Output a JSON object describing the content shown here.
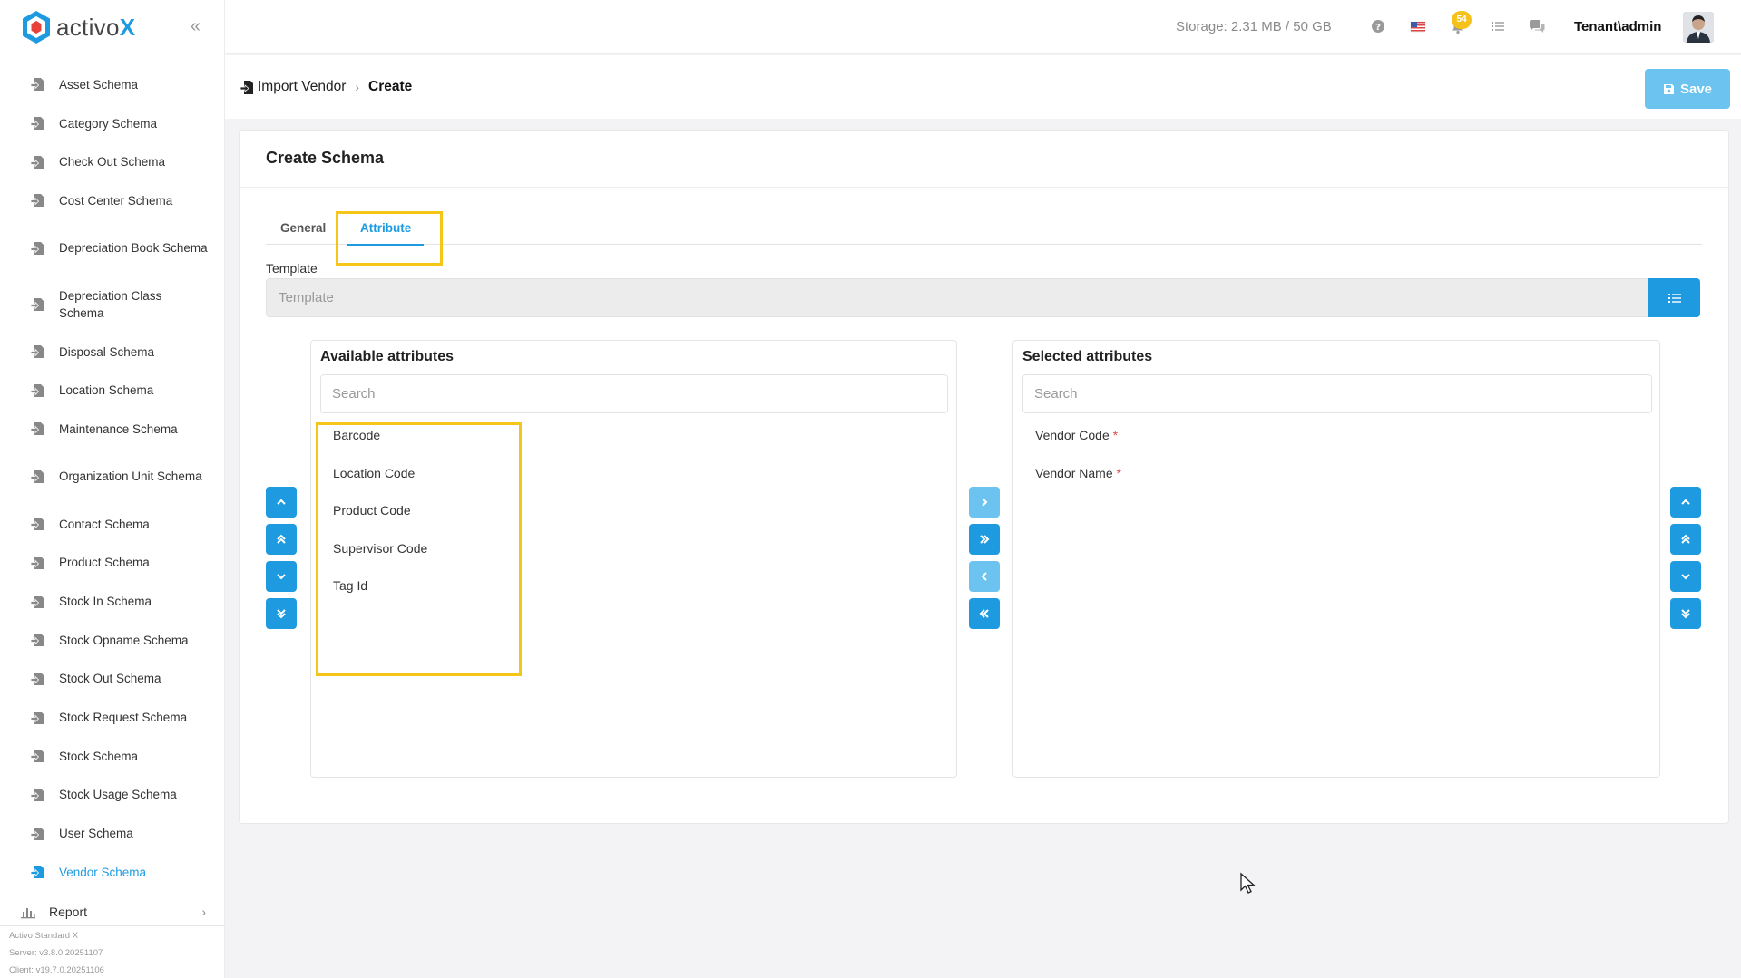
{
  "app": {
    "brand_text": "activo",
    "brand_x": "X",
    "brand_color": "#1e9be0",
    "accent_color": "#1e9be0",
    "highlight_color": "#f5c518"
  },
  "sidebar": {
    "items": [
      {
        "label": "Asset Schema"
      },
      {
        "label": "Category Schema"
      },
      {
        "label": "Check Out Schema"
      },
      {
        "label": "Cost Center Schema"
      },
      {
        "label": "Depreciation Book Schema"
      },
      {
        "label": "Depreciation Class Schema"
      },
      {
        "label": "Disposal Schema"
      },
      {
        "label": "Location Schema"
      },
      {
        "label": "Maintenance Schema"
      },
      {
        "label": "Organization Unit Schema"
      },
      {
        "label": "Contact Schema"
      },
      {
        "label": "Product Schema"
      },
      {
        "label": "Stock In Schema"
      },
      {
        "label": "Stock Opname Schema"
      },
      {
        "label": "Stock Out Schema"
      },
      {
        "label": "Stock Request Schema"
      },
      {
        "label": "Stock Schema"
      },
      {
        "label": "Stock Usage Schema"
      },
      {
        "label": "User Schema"
      },
      {
        "label": "Vendor Schema",
        "active": true
      }
    ],
    "report_label": "Report",
    "version_product": "Activo Standard X",
    "version_server": "Server: v3.8.0.20251107",
    "version_client": "Client: v19.7.0.20251106"
  },
  "header": {
    "storage": "Storage: 2.31 MB / 50 GB",
    "notification_count": "54",
    "user": "Tenant\\admin",
    "icons": [
      "help-icon",
      "us-flag-icon",
      "bell-icon",
      "task-list-icon",
      "chat-icon"
    ]
  },
  "page": {
    "breadcrumb_parent": "Import Vendor",
    "breadcrumb_current": "Create",
    "save_label": "Save"
  },
  "card": {
    "title": "Create Schema",
    "tabs": [
      {
        "label": "General"
      },
      {
        "label": "Attribute",
        "active": true
      }
    ],
    "template_label": "Template",
    "template_placeholder": "Template"
  },
  "available": {
    "title": "Available attributes",
    "search_placeholder": "Search",
    "items": [
      "Barcode",
      "Location Code",
      "Product Code",
      "Supervisor Code",
      "Tag Id"
    ]
  },
  "selected": {
    "title": "Selected attributes",
    "search_placeholder": "Search",
    "items": [
      {
        "label": "Vendor Code",
        "required_mark": "*"
      },
      {
        "label": "Vendor Name",
        "required_mark": "*"
      }
    ]
  }
}
